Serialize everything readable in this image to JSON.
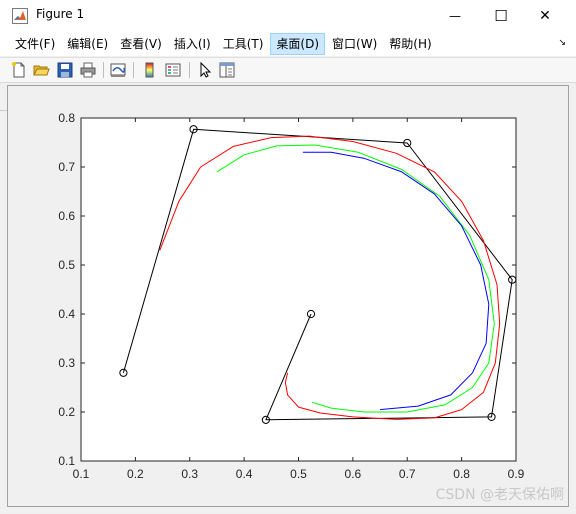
{
  "window": {
    "title": "Figure 1",
    "minimize_glyph": "—",
    "maximize_glyph": "☐",
    "close_glyph": "✕"
  },
  "menu": {
    "items": [
      "文件(F)",
      "编辑(E)",
      "查看(V)",
      "插入(I)",
      "工具(T)",
      "桌面(D)",
      "窗口(W)",
      "帮助(H)"
    ],
    "active_index": 5,
    "overflow_glyph": "↘"
  },
  "toolbar": {
    "icons": [
      "new-figure-icon",
      "open-file-icon",
      "save-icon",
      "print-icon",
      "link-plot-icon",
      "colorbar-icon",
      "legend-icon",
      "pointer-icon",
      "property-editor-icon"
    ]
  },
  "watermark": "CSDN @老天保佑啊",
  "colors": {
    "red": "#ff0000",
    "green": "#00ff00",
    "blue": "#0000ff",
    "black": "#000000"
  },
  "chart_data": {
    "type": "line",
    "title": "",
    "xlabel": "",
    "ylabel": "",
    "xlim": [
      0.1,
      0.9
    ],
    "ylim": [
      0.1,
      0.8
    ],
    "xticks": [
      "0.1",
      "0.2",
      "0.3",
      "0.4",
      "0.5",
      "0.6",
      "0.7",
      "0.8",
      "0.9"
    ],
    "yticks": [
      "0.1",
      "0.2",
      "0.3",
      "0.4",
      "0.5",
      "0.6",
      "0.7",
      "0.8"
    ],
    "grid": false,
    "series": [
      {
        "color": "#000000",
        "marker": "circle",
        "x": [
          0.178,
          0.307,
          0.7,
          0.893,
          0.855,
          0.44,
          0.523
        ],
        "y": [
          0.28,
          0.777,
          0.749,
          0.47,
          0.19,
          0.184,
          0.4
        ]
      },
      {
        "color": "#ff0000",
        "x": [
          0.245,
          0.28,
          0.32,
          0.38,
          0.45,
          0.52,
          0.6,
          0.68,
          0.75,
          0.8,
          0.84,
          0.865,
          0.87,
          0.862,
          0.84,
          0.8,
          0.75,
          0.68,
          0.6,
          0.54,
          0.5,
          0.48,
          0.476,
          0.48
        ],
        "y": [
          0.53,
          0.63,
          0.7,
          0.742,
          0.76,
          0.763,
          0.752,
          0.728,
          0.69,
          0.63,
          0.55,
          0.46,
          0.38,
          0.3,
          0.24,
          0.205,
          0.188,
          0.185,
          0.19,
          0.198,
          0.21,
          0.235,
          0.26,
          0.28
        ]
      },
      {
        "color": "#00ff00",
        "x": [
          0.35,
          0.4,
          0.46,
          0.53,
          0.61,
          0.69,
          0.76,
          0.815,
          0.85,
          0.86,
          0.85,
          0.82,
          0.77,
          0.7,
          0.62,
          0.56,
          0.525
        ],
        "y": [
          0.69,
          0.725,
          0.743,
          0.745,
          0.73,
          0.695,
          0.64,
          0.56,
          0.47,
          0.38,
          0.3,
          0.25,
          0.215,
          0.2,
          0.2,
          0.208,
          0.22
        ]
      },
      {
        "color": "#0000ff",
        "x": [
          0.508,
          0.56,
          0.62,
          0.69,
          0.75,
          0.8,
          0.835,
          0.85,
          0.845,
          0.82,
          0.78,
          0.72,
          0.65
        ],
        "y": [
          0.73,
          0.73,
          0.718,
          0.69,
          0.645,
          0.58,
          0.5,
          0.42,
          0.34,
          0.28,
          0.235,
          0.212,
          0.205
        ]
      }
    ]
  }
}
